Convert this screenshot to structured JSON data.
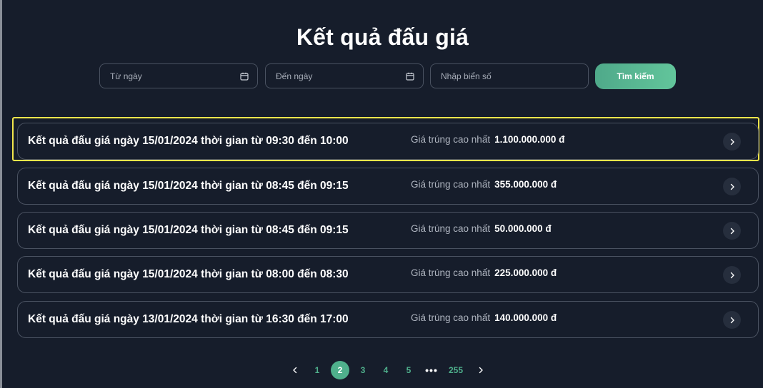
{
  "page": {
    "title": "Kết quả đấu giá"
  },
  "filters": {
    "from_date": {
      "placeholder": "Từ ngày",
      "icon": "calendar-icon"
    },
    "to_date": {
      "placeholder": "Đến ngày",
      "icon": "calendar-icon"
    },
    "plate": {
      "placeholder": "Nhập biển số"
    },
    "search_label": "Tìm kiếm"
  },
  "results": [
    {
      "title": "Kết quả đấu giá ngày 15/01/2024 thời gian từ 09:30 đến 10:00",
      "price_label": "Giá trúng cao nhất",
      "price": "1.100.000.000 đ",
      "highlighted": true
    },
    {
      "title": "Kết quả đấu giá ngày 15/01/2024 thời gian từ 08:45 đến 09:15",
      "price_label": "Giá trúng cao nhất",
      "price": "355.000.000 đ"
    },
    {
      "title": "Kết quả đấu giá ngày 15/01/2024 thời gian từ 08:45 đến 09:15",
      "price_label": "Giá trúng cao nhất",
      "price": "50.000.000 đ"
    },
    {
      "title": "Kết quả đấu giá ngày 15/01/2024 thời gian từ 08:00 đến 08:30",
      "price_label": "Giá trúng cao nhất",
      "price": "225.000.000 đ"
    },
    {
      "title": "Kết quả đấu giá ngày 13/01/2024 thời gian từ 16:30 đến 17:00",
      "price_label": "Giá trúng cao nhất",
      "price": "140.000.000 đ"
    }
  ],
  "pagination": {
    "pages": [
      "1",
      "2",
      "3",
      "4",
      "5"
    ],
    "current": "2",
    "ellipsis": "•••",
    "last": "255"
  },
  "colors": {
    "background": "#161d2b",
    "accent": "#4fb08c",
    "highlight": "#f2e64b"
  }
}
